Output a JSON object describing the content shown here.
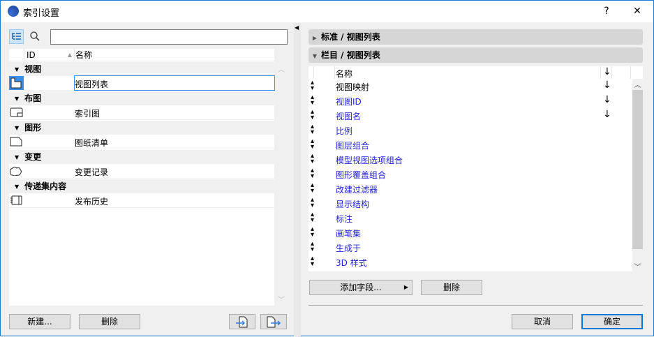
{
  "window": {
    "title": "索引设置",
    "help": "?",
    "close": "✕"
  },
  "left": {
    "search": {
      "placeholder": "",
      "value": ""
    },
    "columns": {
      "id": "ID",
      "name": "名称"
    },
    "groups": [
      {
        "label": "视图",
        "items": [
          {
            "id": "",
            "name": "视图列表",
            "icon": "view-list-icon",
            "selected": true
          }
        ]
      },
      {
        "label": "布图",
        "items": [
          {
            "id": "",
            "name": "索引图",
            "icon": "layout-icon"
          }
        ]
      },
      {
        "label": "图形",
        "items": [
          {
            "id": "",
            "name": "图纸清单",
            "icon": "drawing-icon"
          }
        ]
      },
      {
        "label": "变更",
        "items": [
          {
            "id": "",
            "name": "变更记录",
            "icon": "cloud-icon"
          }
        ]
      },
      {
        "label": "传递集内容",
        "items": [
          {
            "id": "",
            "name": "发布历史",
            "icon": "notebook-icon"
          }
        ]
      }
    ],
    "buttons": {
      "new": "新建...",
      "delete": "删除"
    }
  },
  "right": {
    "sections": [
      {
        "label": "标准 /  视图列表",
        "expanded": false
      },
      {
        "label": "栏目 /  视图列表",
        "expanded": true
      }
    ],
    "header": {
      "name": "名称",
      "sort": "↓"
    },
    "fields": [
      {
        "name": "视图映射",
        "sort": "↓",
        "color": "#000000"
      },
      {
        "name": "视图ID",
        "sort": "↓",
        "color": "#2323d6"
      },
      {
        "name": "视图名",
        "sort": "↓",
        "color": "#2323d6"
      },
      {
        "name": "比例",
        "sort": "",
        "color": "#2323d6"
      },
      {
        "name": "图层组合",
        "sort": "",
        "color": "#2323d6"
      },
      {
        "name": "模型视图选项组合",
        "sort": "",
        "color": "#2323d6"
      },
      {
        "name": "图形覆盖组合",
        "sort": "",
        "color": "#2323d6"
      },
      {
        "name": "改建过滤器",
        "sort": "",
        "color": "#2323d6"
      },
      {
        "name": "显示结构",
        "sort": "",
        "color": "#2323d6"
      },
      {
        "name": "标注",
        "sort": "",
        "color": "#2323d6"
      },
      {
        "name": "画笔集",
        "sort": "",
        "color": "#2323d6"
      },
      {
        "name": "生成于",
        "sort": "",
        "color": "#2323d6"
      },
      {
        "name": "3D 样式",
        "sort": "",
        "color": "#2323d6"
      }
    ],
    "buttons": {
      "add_field": "添加字段...",
      "delete": "删除"
    }
  },
  "footer": {
    "cancel": "取消",
    "ok": "确定"
  }
}
